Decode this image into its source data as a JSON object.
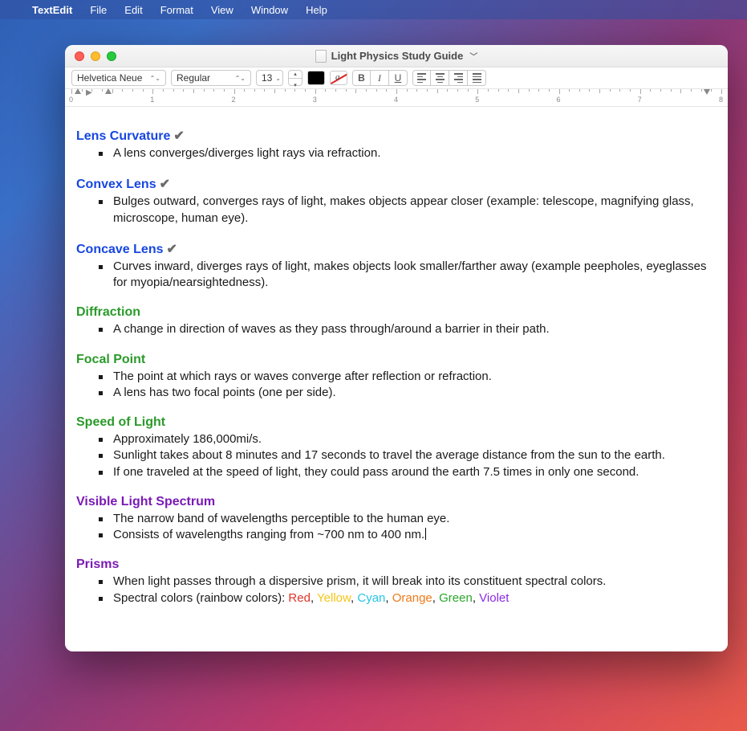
{
  "menubar": {
    "app": "TextEdit",
    "items": [
      "File",
      "Edit",
      "Format",
      "View",
      "Window",
      "Help"
    ]
  },
  "window": {
    "title": "Light Physics Study Guide"
  },
  "toolbar": {
    "font_name": "Helvetica Neue",
    "font_style": "Regular",
    "font_size": "13"
  },
  "ruler": {
    "numbers": [
      "0",
      "1",
      "2",
      "3",
      "4",
      "5",
      "6",
      "7",
      "8"
    ]
  },
  "sections": [
    {
      "title": "Lens Curvature",
      "title_color": "blue",
      "checked": true,
      "items": [
        "A lens converges/diverges light rays via refraction."
      ]
    },
    {
      "title": "Convex Lens",
      "title_color": "blue",
      "checked": true,
      "items": [
        "Bulges outward, converges rays of light, makes objects appear closer (example: telescope, magnifying glass, microscope, human eye)."
      ]
    },
    {
      "title": "Concave Lens",
      "title_color": "blue",
      "checked": true,
      "items": [
        "Curves inward, diverges rays of light, makes objects look smaller/farther away (example peepholes, eyeglasses for myopia/nearsightedness)."
      ]
    },
    {
      "title": "Diffraction",
      "title_color": "green",
      "checked": false,
      "items": [
        "A change in direction of waves as they pass through/around a barrier in their path."
      ]
    },
    {
      "title": "Focal Point",
      "title_color": "green",
      "checked": false,
      "items": [
        "The point at which rays or waves converge after reflection or refraction.",
        "A lens has two focal points (one per side)."
      ]
    },
    {
      "title": "Speed of Light",
      "title_color": "green",
      "checked": false,
      "items": [
        "Approximately 186,000mi/s.",
        "Sunlight takes about 8 minutes and 17 seconds to travel the average distance from the sun to the earth.",
        "If one traveled at the speed of light, they could pass around the earth 7.5 times in only one second."
      ]
    },
    {
      "title": "Visible Light Spectrum",
      "title_color": "purple",
      "checked": false,
      "items": [
        "The narrow band of wavelengths perceptible to the human eye.",
        "Consists of wavelengths ranging from ~700 nm to 400 nm."
      ]
    },
    {
      "title": "Prisms",
      "title_color": "purple",
      "checked": false,
      "items": [
        "When light passes through a dispersive prism, it will break into its constituent spectral colors."
      ],
      "spectral_prefix": "Spectral colors (rainbow colors): ",
      "spectral": [
        {
          "text": "Red",
          "color": "red"
        },
        {
          "text": "Yellow",
          "color": "yellow"
        },
        {
          "text": "Cyan",
          "color": "cyan"
        },
        {
          "text": "Orange",
          "color": "orange"
        },
        {
          "text": "Green",
          "color": "green"
        },
        {
          "text": "Violet",
          "color": "violet"
        }
      ]
    }
  ],
  "cursor_section_index": 6,
  "cursor_item_index": 1
}
